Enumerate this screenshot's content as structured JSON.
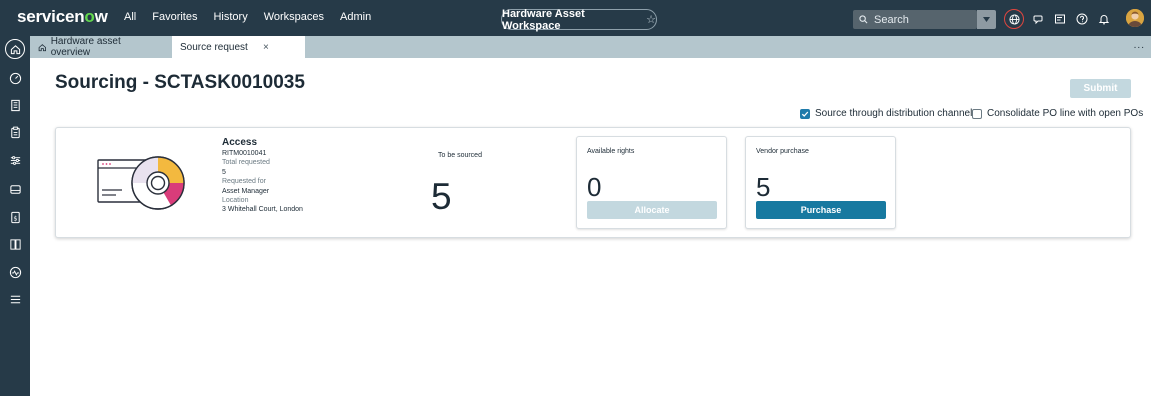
{
  "header": {
    "logo_prefix": "servicen",
    "logo_o": "o",
    "logo_suffix": "w",
    "nav": [
      "All",
      "Favorites",
      "History",
      "Workspaces",
      "Admin"
    ],
    "workspace": "Hardware Asset Workspace",
    "search_placeholder": "Search"
  },
  "tabs": {
    "overview": "Hardware asset overview",
    "source_request": "Source request",
    "close": "×",
    "more": "..."
  },
  "page": {
    "title": "Sourcing - SCTASK0010035",
    "submit": "Submit",
    "option_distribution": "Source through distribution channel",
    "option_distribution_checked": true,
    "option_consolidate": "Consolidate PO line with open POs",
    "option_consolidate_checked": false
  },
  "item": {
    "name": "Access",
    "ritm": "RITM0010041",
    "total_requested_label": "Total requested",
    "total_requested": "5",
    "requested_for_label": "Requested for",
    "requested_for": "Asset Manager",
    "location_label": "Location",
    "location": "3 Whitehall Court, London",
    "to_be_sourced_label": "To be sourced",
    "to_be_sourced": "5"
  },
  "available_rights": {
    "title": "Available rights",
    "value": "0",
    "button": "Allocate"
  },
  "vendor_purchase": {
    "title": "Vendor purchase",
    "value": "5",
    "button": "Purchase"
  },
  "colors": {
    "topbar": "#263a48",
    "accent": "#1779a0",
    "logo_o": "#62d84e",
    "disabled_button": "#c3d8df"
  }
}
